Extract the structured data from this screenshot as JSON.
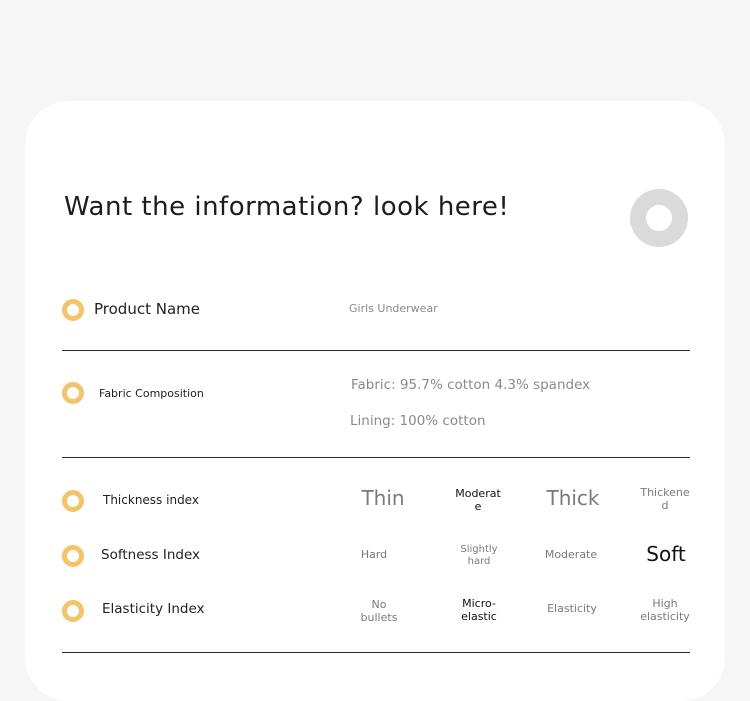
{
  "headline": "Want the information? look here!",
  "rows": {
    "product_name": {
      "label": "Product Name",
      "value": "Girls Underwear"
    },
    "fabric": {
      "label": "Fabric Composition",
      "fabric_value": "Fabric: 95.7% cotton 4.3% spandex",
      "lining_value": "Lining: 100% cotton"
    },
    "thickness": {
      "label": "Thickness index",
      "options": [
        "Thin",
        "Moderat\ne",
        "Thick",
        "Thickene\nd"
      ]
    },
    "softness": {
      "label": "Softness Index",
      "options": [
        "Hard",
        "Slightly\nhard",
        "Moderate",
        "Soft"
      ]
    },
    "elasticity": {
      "label": "Elasticity Index",
      "options": [
        "No\nbullets",
        "Micro-\nelastic",
        "Elasticity",
        "High\nelasticity"
      ]
    }
  },
  "colors": {
    "accent": "#f2c46c",
    "divider": "#2b2b2b",
    "page_bg": "#f6f6f6",
    "card_bg": "#ffffff"
  }
}
